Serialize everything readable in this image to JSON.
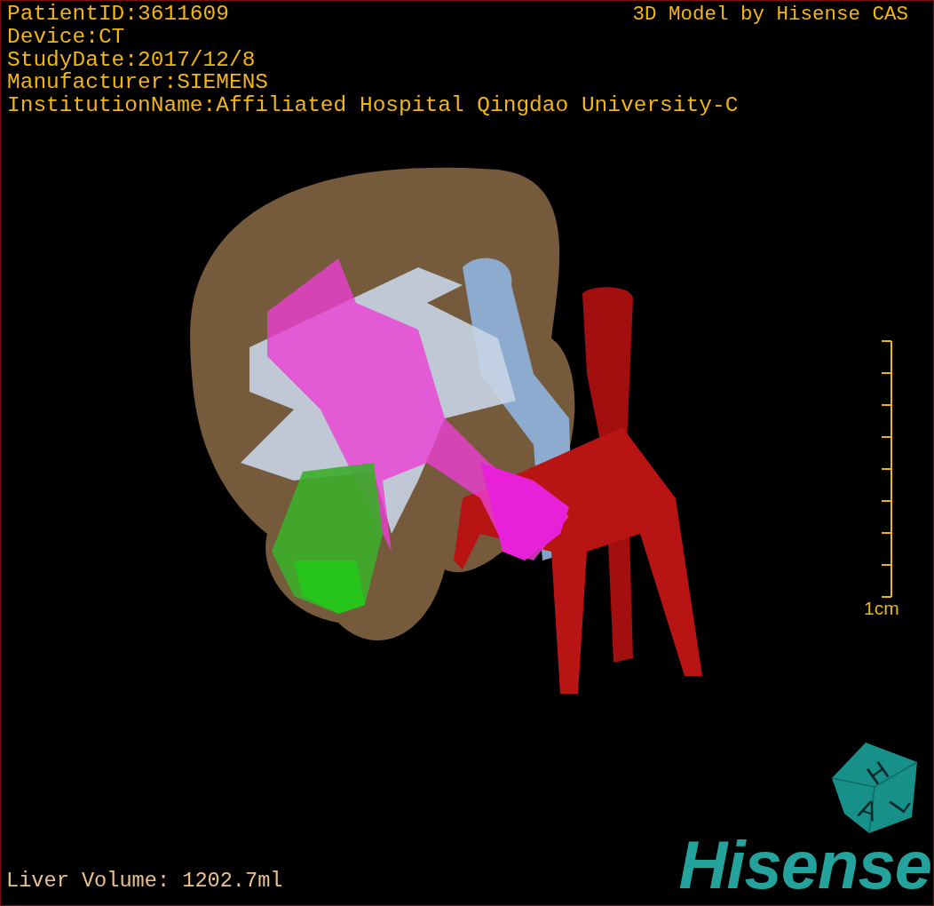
{
  "info_lines": [
    {
      "text": "PatientID:3611609"
    },
    {
      "text": "Device:CT"
    },
    {
      "text": "StudyDate:2017/12/8"
    },
    {
      "text": "Manufacturer:SIEMENS"
    },
    {
      "text": "InstitutionName:Affiliated Hospital Qingdao University-C"
    }
  ],
  "model_caption": "3D Model by Hisense CAS",
  "scale_bar": {
    "label": "1cm"
  },
  "liver_volume": "Liver Volume: 1202.7ml",
  "logo": {
    "cube_letters": [
      "H",
      "A",
      "L"
    ],
    "wordmark": "Hisense"
  }
}
